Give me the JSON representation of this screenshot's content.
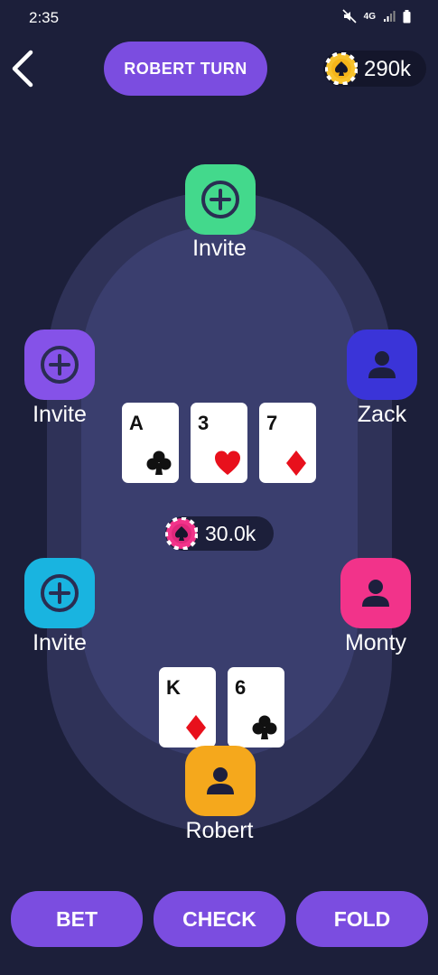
{
  "status_bar": {
    "time": "2:35",
    "network": "4G"
  },
  "header": {
    "turn_label": "ROBERT TURN",
    "balance": "290k",
    "back_icon": "chevron-left-icon",
    "balance_icon": "spade-chip-icon"
  },
  "colors": {
    "background": "#1c1f3a",
    "table_outer": "#2f3258",
    "table_inner": "#3a3e6e",
    "accent": "#7b4de0",
    "seat_top": "#43d98c",
    "seat_left_upper": "#8552e8",
    "seat_left_lower": "#19b4e0",
    "seat_zack": "#3a34d8",
    "seat_monty": "#f2338a",
    "seat_robert": "#f5a81c",
    "suit_red": "#e8101c",
    "suit_black": "#111111"
  },
  "seats": {
    "top": {
      "label": "Invite",
      "icon": "plus-circle-icon"
    },
    "left_upper": {
      "label": "Invite",
      "icon": "plus-circle-icon"
    },
    "left_lower": {
      "label": "Invite",
      "icon": "plus-circle-icon"
    },
    "right_upper": {
      "label": "Zack",
      "icon": "user-icon"
    },
    "right_lower": {
      "label": "Monty",
      "icon": "user-icon"
    },
    "bottom": {
      "label": "Robert",
      "icon": "user-icon"
    }
  },
  "community_cards": [
    {
      "rank": "A",
      "suit": "clubs"
    },
    {
      "rank": "3",
      "suit": "hearts"
    },
    {
      "rank": "7",
      "suit": "diamonds"
    }
  ],
  "pot": {
    "value": "30.0k",
    "icon": "pink-chip-icon"
  },
  "player_cards": [
    {
      "rank": "K",
      "suit": "diamonds"
    },
    {
      "rank": "6",
      "suit": "clubs"
    }
  ],
  "actions": {
    "bet": "BET",
    "check": "CHECK",
    "fold": "FOLD"
  }
}
